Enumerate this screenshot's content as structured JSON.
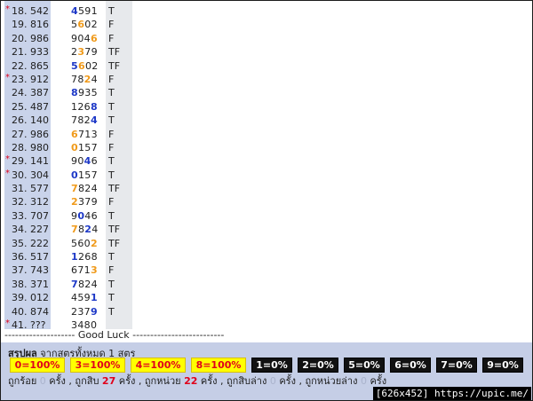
{
  "rows": [
    {
      "star": true,
      "label": "18. 542",
      "digits": [
        {
          "d": "4",
          "c": "b"
        },
        {
          "d": "5",
          "c": ""
        },
        {
          "d": "9",
          "c": ""
        },
        {
          "d": "1",
          "c": ""
        }
      ],
      "result": "T"
    },
    {
      "star": false,
      "label": "19. 816",
      "digits": [
        {
          "d": "5",
          "c": ""
        },
        {
          "d": "6",
          "c": "o"
        },
        {
          "d": "0",
          "c": ""
        },
        {
          "d": "2",
          "c": ""
        }
      ],
      "result": "F"
    },
    {
      "star": false,
      "label": "20. 986",
      "digits": [
        {
          "d": "9",
          "c": ""
        },
        {
          "d": "0",
          "c": ""
        },
        {
          "d": "4",
          "c": ""
        },
        {
          "d": "6",
          "c": "o"
        }
      ],
      "result": "F"
    },
    {
      "star": false,
      "label": "21. 933",
      "digits": [
        {
          "d": "2",
          "c": ""
        },
        {
          "d": "3",
          "c": "o"
        },
        {
          "d": "7",
          "c": ""
        },
        {
          "d": "9",
          "c": ""
        }
      ],
      "result": "TF"
    },
    {
      "star": false,
      "label": "22. 865",
      "digits": [
        {
          "d": "5",
          "c": "b"
        },
        {
          "d": "6",
          "c": "o"
        },
        {
          "d": "0",
          "c": ""
        },
        {
          "d": "2",
          "c": ""
        }
      ],
      "result": "TF"
    },
    {
      "star": true,
      "label": "23. 912",
      "digits": [
        {
          "d": "7",
          "c": ""
        },
        {
          "d": "8",
          "c": ""
        },
        {
          "d": "2",
          "c": "o"
        },
        {
          "d": "4",
          "c": ""
        }
      ],
      "result": "F"
    },
    {
      "star": false,
      "label": "24. 387",
      "digits": [
        {
          "d": "8",
          "c": "b"
        },
        {
          "d": "9",
          "c": ""
        },
        {
          "d": "3",
          "c": ""
        },
        {
          "d": "5",
          "c": ""
        }
      ],
      "result": "T"
    },
    {
      "star": false,
      "label": "25. 487",
      "digits": [
        {
          "d": "1",
          "c": ""
        },
        {
          "d": "2",
          "c": ""
        },
        {
          "d": "6",
          "c": ""
        },
        {
          "d": "8",
          "c": "b"
        }
      ],
      "result": "T"
    },
    {
      "star": false,
      "label": "26. 140",
      "digits": [
        {
          "d": "7",
          "c": ""
        },
        {
          "d": "8",
          "c": ""
        },
        {
          "d": "2",
          "c": ""
        },
        {
          "d": "4",
          "c": "b"
        }
      ],
      "result": "T"
    },
    {
      "star": false,
      "label": "27. 986",
      "digits": [
        {
          "d": "6",
          "c": "o"
        },
        {
          "d": "7",
          "c": ""
        },
        {
          "d": "1",
          "c": ""
        },
        {
          "d": "3",
          "c": ""
        }
      ],
      "result": "F"
    },
    {
      "star": false,
      "label": "28. 980",
      "digits": [
        {
          "d": "0",
          "c": "o"
        },
        {
          "d": "1",
          "c": ""
        },
        {
          "d": "5",
          "c": ""
        },
        {
          "d": "7",
          "c": ""
        }
      ],
      "result": "F"
    },
    {
      "star": true,
      "label": "29. 141",
      "digits": [
        {
          "d": "9",
          "c": ""
        },
        {
          "d": "0",
          "c": ""
        },
        {
          "d": "4",
          "c": "b"
        },
        {
          "d": "6",
          "c": ""
        }
      ],
      "result": "T"
    },
    {
      "star": true,
      "label": "30. 304",
      "digits": [
        {
          "d": "0",
          "c": "b"
        },
        {
          "d": "1",
          "c": ""
        },
        {
          "d": "5",
          "c": ""
        },
        {
          "d": "7",
          "c": ""
        }
      ],
      "result": "T"
    },
    {
      "star": false,
      "label": "31. 577",
      "digits": [
        {
          "d": "7",
          "c": "o"
        },
        {
          "d": "8",
          "c": ""
        },
        {
          "d": "2",
          "c": ""
        },
        {
          "d": "4",
          "c": ""
        }
      ],
      "result": "TF"
    },
    {
      "star": false,
      "label": "32. 312",
      "digits": [
        {
          "d": "2",
          "c": "o"
        },
        {
          "d": "3",
          "c": ""
        },
        {
          "d": "7",
          "c": ""
        },
        {
          "d": "9",
          "c": ""
        }
      ],
      "result": "F"
    },
    {
      "star": false,
      "label": "33. 707",
      "digits": [
        {
          "d": "9",
          "c": ""
        },
        {
          "d": "0",
          "c": "b"
        },
        {
          "d": "4",
          "c": ""
        },
        {
          "d": "6",
          "c": ""
        }
      ],
      "result": "T"
    },
    {
      "star": false,
      "label": "34. 227",
      "digits": [
        {
          "d": "7",
          "c": "o"
        },
        {
          "d": "8",
          "c": ""
        },
        {
          "d": "2",
          "c": "b"
        },
        {
          "d": "4",
          "c": ""
        }
      ],
      "result": "TF"
    },
    {
      "star": false,
      "label": "35. 222",
      "digits": [
        {
          "d": "5",
          "c": ""
        },
        {
          "d": "6",
          "c": ""
        },
        {
          "d": "0",
          "c": ""
        },
        {
          "d": "2",
          "c": "o"
        }
      ],
      "result": "TF"
    },
    {
      "star": false,
      "label": "36. 517",
      "digits": [
        {
          "d": "1",
          "c": "b"
        },
        {
          "d": "2",
          "c": ""
        },
        {
          "d": "6",
          "c": ""
        },
        {
          "d": "8",
          "c": ""
        }
      ],
      "result": "T"
    },
    {
      "star": false,
      "label": "37. 743",
      "digits": [
        {
          "d": "6",
          "c": ""
        },
        {
          "d": "7",
          "c": ""
        },
        {
          "d": "1",
          "c": ""
        },
        {
          "d": "3",
          "c": "o"
        }
      ],
      "result": "F"
    },
    {
      "star": false,
      "label": "38. 371",
      "digits": [
        {
          "d": "7",
          "c": "b"
        },
        {
          "d": "8",
          "c": ""
        },
        {
          "d": "2",
          "c": ""
        },
        {
          "d": "4",
          "c": ""
        }
      ],
      "result": "T"
    },
    {
      "star": false,
      "label": "39. 012",
      "digits": [
        {
          "d": "4",
          "c": ""
        },
        {
          "d": "5",
          "c": ""
        },
        {
          "d": "9",
          "c": ""
        },
        {
          "d": "1",
          "c": "b"
        }
      ],
      "result": "T"
    },
    {
      "star": false,
      "label": "40. 874",
      "digits": [
        {
          "d": "2",
          "c": ""
        },
        {
          "d": "3",
          "c": ""
        },
        {
          "d": "7",
          "c": ""
        },
        {
          "d": "9",
          "c": "b"
        }
      ],
      "result": "T"
    },
    {
      "star": true,
      "label": "41. ???",
      "digits": [
        {
          "d": "3",
          "c": ""
        },
        {
          "d": "4",
          "c": ""
        },
        {
          "d": "8",
          "c": ""
        },
        {
          "d": "0",
          "c": ""
        }
      ],
      "result": ""
    }
  ],
  "star_char": "*",
  "good_luck_line": "-------------------- Good Luck --------------------------",
  "summary": {
    "title_bold": "สรุปผล",
    "title_rest": " จากสูตรทั้งหมด 1 สูตร",
    "badges": [
      {
        "label": "0=100%",
        "type": "yes"
      },
      {
        "label": "3=100%",
        "type": "yes"
      },
      {
        "label": "4=100%",
        "type": "yes"
      },
      {
        "label": "8=100%",
        "type": "yes"
      },
      {
        "label": "1=0%",
        "type": "no"
      },
      {
        "label": "2=0%",
        "type": "no"
      },
      {
        "label": "5=0%",
        "type": "no"
      },
      {
        "label": "6=0%",
        "type": "no"
      },
      {
        "label": "7=0%",
        "type": "no"
      },
      {
        "label": "9=0%",
        "type": "no"
      }
    ],
    "bottom": {
      "t1": "ถูกร้อย ",
      "v1": "0",
      "t2": " ครั้ง , ถูกสิบ ",
      "v2": "27",
      "t3": " ครั้ง , ถูกหน่วย ",
      "v3": "22",
      "t4": " ครั้ง , ถูกสิบล่าง ",
      "v4": "0",
      "t5": " ครั้ง , ถูกหน่วยล่าง ",
      "v5": "0",
      "t6": " ครั้ง"
    }
  },
  "watermark": "[626x452] https://upic.me/",
  "colors": {
    "blue": "#1d38c7",
    "orange": "#f09a1a",
    "red": "#e0001b",
    "yellow": "#ffff00"
  }
}
